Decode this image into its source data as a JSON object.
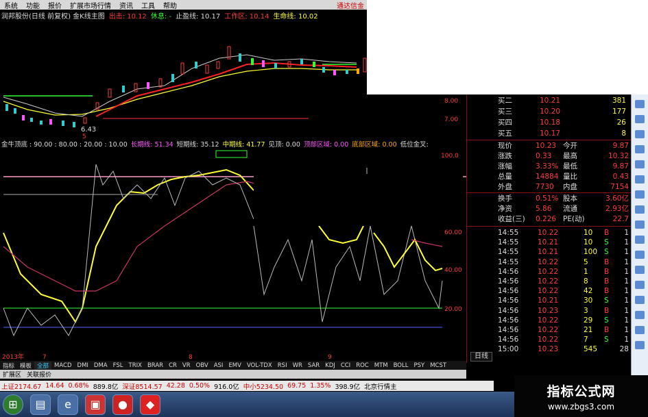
{
  "menu": {
    "items": [
      "系统",
      "功能",
      "报价",
      "扩展市场行情",
      "资讯",
      "工具",
      "帮助"
    ],
    "brand": "通达信金"
  },
  "top_info": {
    "title": "润邦股份(日线 前复权) 金K线主图",
    "chu": "出击: 10.12",
    "xiuxi": "休息: -",
    "zhiying": "止盈线: 10.17",
    "gongzuo": "工作区: 10.14",
    "shengming": "生命线: 10.02"
  },
  "price_labels": {
    "low": "6.43",
    "low_day": "5"
  },
  "indicator": {
    "name": "金牛顶底 : 90.00 : 80.00 : 20.00 : 10.00",
    "long": "长期线: 51.34",
    "short": "短期线: 35.12",
    "mid": "中期线: 41.77",
    "top": "见顶: 0.00",
    "topzone": "顶部区域: 0.00",
    "botzone": "底部区域: 0.00",
    "cross": "低位金叉:"
  },
  "axis": {
    "p8": "8.00",
    "p7": "7.00",
    "p100": "100.0",
    "p60": "60.00",
    "p40": "40.00",
    "p20": "20.00"
  },
  "quote": {
    "levels": [
      {
        "label": "买二",
        "price": "10.21",
        "vol": "381"
      },
      {
        "label": "买三",
        "price": "10.20",
        "vol": "177"
      },
      {
        "label": "买四",
        "price": "10.18",
        "vol": "26"
      },
      {
        "label": "买五",
        "price": "10.17",
        "vol": "8"
      }
    ],
    "stats": [
      {
        "a": "现价",
        "av": "10.23",
        "b": "今开",
        "bv": "9.87"
      },
      {
        "a": "涨跌",
        "av": "0.33",
        "b": "最高",
        "bv": "10.32"
      },
      {
        "a": "涨幅",
        "av": "3.33%",
        "b": "最低",
        "bv": "9.87"
      },
      {
        "a": "总量",
        "av": "14884",
        "b": "量比",
        "bv": "0.43"
      },
      {
        "a": "外盘",
        "av": "7730",
        "b": "内盘",
        "bv": "7154"
      }
    ],
    "stats2": [
      {
        "a": "换手",
        "av": "0.51%",
        "b": "股本",
        "bv": "3.60亿"
      },
      {
        "a": "净资",
        "av": "5.86",
        "b": "流通",
        "bv": "2.93亿"
      },
      {
        "a": "收益(三)",
        "av": "0.226",
        "b": "PE(动)",
        "bv": "22.7"
      }
    ],
    "ticks": [
      {
        "t": "14:55",
        "p": "10.22",
        "v": "10",
        "s": "B",
        "n": "1"
      },
      {
        "t": "14:55",
        "p": "10.21",
        "v": "10",
        "s": "S",
        "n": "1"
      },
      {
        "t": "14:55",
        "p": "10.21",
        "v": "100",
        "s": "S",
        "n": "1"
      },
      {
        "t": "14:55",
        "p": "10.22",
        "v": "5",
        "s": "B",
        "n": "1"
      },
      {
        "t": "14:56",
        "p": "10.22",
        "v": "1",
        "s": "B",
        "n": "1"
      },
      {
        "t": "14:56",
        "p": "10.22",
        "v": "8",
        "s": "B",
        "n": "1"
      },
      {
        "t": "14:56",
        "p": "10.22",
        "v": "42",
        "s": "B",
        "n": "1"
      },
      {
        "t": "14:56",
        "p": "10.21",
        "v": "30",
        "s": "S",
        "n": "1"
      },
      {
        "t": "14:56",
        "p": "10.23",
        "v": "3",
        "s": "B",
        "n": "1"
      },
      {
        "t": "14:56",
        "p": "10.22",
        "v": "29",
        "s": "S",
        "n": "1"
      },
      {
        "t": "14:56",
        "p": "10.22",
        "v": "21",
        "s": "B",
        "n": "1"
      },
      {
        "t": "14:56",
        "p": "10.22",
        "v": "7",
        "s": "S",
        "n": "1"
      },
      {
        "t": "15:00",
        "p": "10.23",
        "v": "545",
        "s": "",
        "n": "28"
      }
    ]
  },
  "bottom": {
    "year": "2013年",
    "m7": "7",
    "m8": "8",
    "m9": "9",
    "tabs": [
      "指标",
      "模板",
      "全部",
      "MACD",
      "DMI",
      "DMA",
      "FSL",
      "TRIX",
      "BRAR",
      "CR",
      "VR",
      "OBV",
      "ASI",
      "EMV",
      "VOL-TDX",
      "RSI",
      "WR",
      "SAR",
      "KDJ",
      "CCI",
      "ROC",
      "MTM",
      "BOLL",
      "PSY",
      "MCST"
    ],
    "subtabs": [
      "扩展区",
      "关联报价"
    ],
    "day": "日线"
  },
  "status": {
    "sh": "上证2174.67",
    "sh_c": "14.64",
    "sh_p": "0.68%",
    "sh_v": "889.8亿",
    "sz": "深证8514.57",
    "sz_c": "42.28",
    "sz_p": "0.50%",
    "sz_v": "916.0亿",
    "zx": "中小5234.50",
    "zx_c": "69.75",
    "zx_p": "1.35%",
    "zx_v": "398.9亿",
    "bj": "北京行情主"
  },
  "watermark": {
    "t1": "指标公式网",
    "t2": "www.zbgs3.com"
  },
  "colors": {
    "up": "#ff3c3c",
    "down": "#33cccc",
    "yellow": "#ffff33",
    "green": "#33ff33"
  }
}
